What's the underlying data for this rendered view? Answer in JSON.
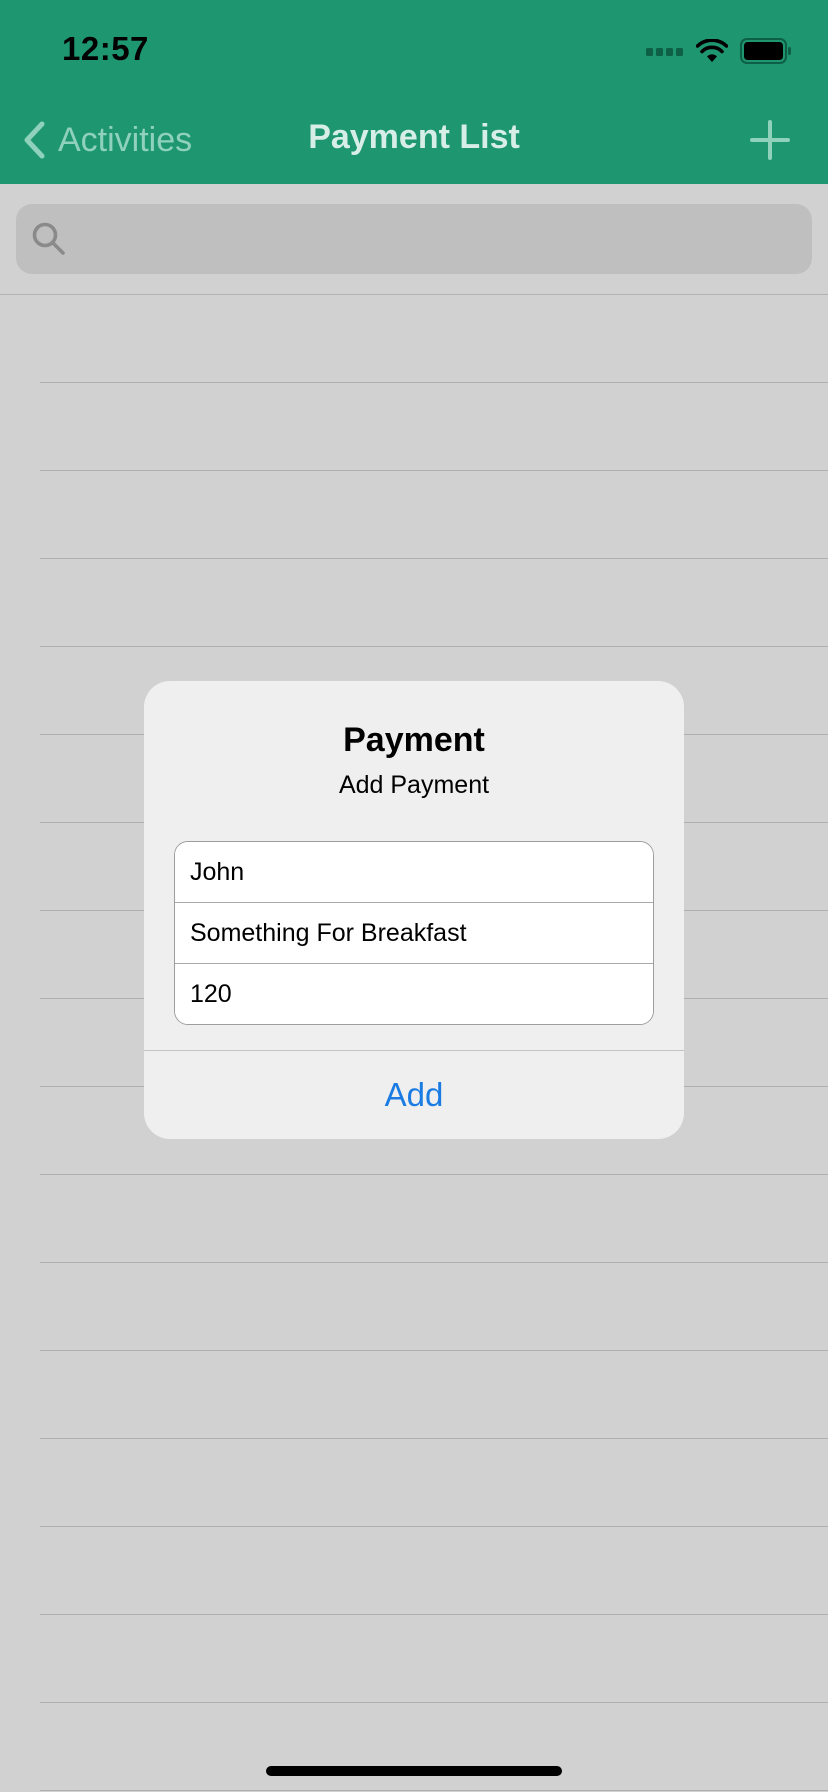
{
  "status_bar": {
    "time": "12:57",
    "icons": [
      "cellular-signal-icon",
      "wifi-icon",
      "battery-icon"
    ]
  },
  "nav": {
    "back_label": "Activities",
    "title": "Payment List",
    "add_icon": "plus-icon"
  },
  "search": {
    "placeholder": "",
    "icon": "search-icon"
  },
  "alert": {
    "title": "Payment",
    "message": "Add Payment",
    "fields": [
      {
        "value": "John"
      },
      {
        "value": "Something For Breakfast"
      },
      {
        "value": "120"
      }
    ],
    "action_label": "Add"
  },
  "colors": {
    "nav_background": "#1e9771",
    "accent_blue": "#1a7ce3",
    "dim_background": "#d1d1d1"
  }
}
